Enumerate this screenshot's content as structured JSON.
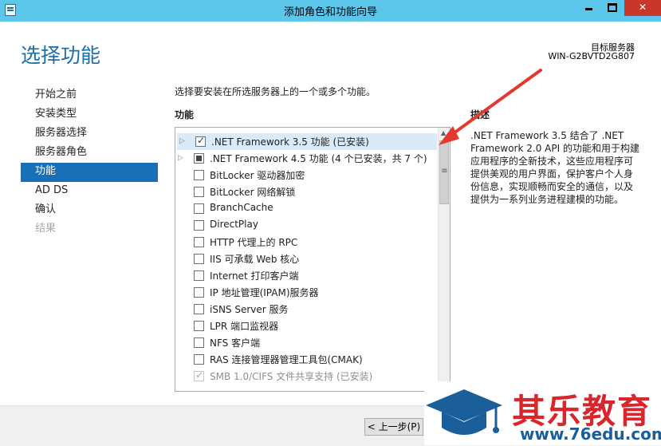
{
  "window": {
    "title": "添加角色和功能向导",
    "close_glyph": "✕"
  },
  "header": {
    "title": "选择功能",
    "target_label": "目标服务器",
    "target_name": "WIN-G2BVTD2G807"
  },
  "nav": {
    "items": [
      {
        "label": "开始之前",
        "state": "normal"
      },
      {
        "label": "安装类型",
        "state": "normal"
      },
      {
        "label": "服务器选择",
        "state": "normal"
      },
      {
        "label": "服务器角色",
        "state": "normal"
      },
      {
        "label": "功能",
        "state": "active"
      },
      {
        "label": "AD DS",
        "state": "normal"
      },
      {
        "label": "确认",
        "state": "normal"
      },
      {
        "label": "结果",
        "state": "disabled"
      }
    ]
  },
  "main": {
    "instruction": "选择要安装在所选服务器上的一个或多个功能。",
    "features_label": "功能",
    "features": [
      {
        "label": ".NET Framework 3.5 功能 (已安装)",
        "check": "checked",
        "expandable": true,
        "selected": true
      },
      {
        "label": ".NET Framework 4.5 功能 (4 个已安装，共 7 个)",
        "check": "partial",
        "expandable": true
      },
      {
        "label": "BitLocker 驱动器加密",
        "check": "none"
      },
      {
        "label": "BitLocker 网络解锁",
        "check": "none"
      },
      {
        "label": "BranchCache",
        "check": "none"
      },
      {
        "label": "DirectPlay",
        "check": "none"
      },
      {
        "label": "HTTP 代理上的 RPC",
        "check": "none"
      },
      {
        "label": "IIS 可承载 Web 核心",
        "check": "none"
      },
      {
        "label": "Internet 打印客户端",
        "check": "none"
      },
      {
        "label": "IP 地址管理(IPAM)服务器",
        "check": "none"
      },
      {
        "label": "iSNS Server 服务",
        "check": "none"
      },
      {
        "label": "LPR 端口监视器",
        "check": "none"
      },
      {
        "label": "NFS 客户端",
        "check": "none"
      },
      {
        "label": "RAS 连接管理器管理工具包(CMAK)",
        "check": "none"
      },
      {
        "label": "SMB 1.0/CIFS 文件共享支持 (已安装)",
        "check": "checked-disabled"
      }
    ]
  },
  "description": {
    "heading": "描述",
    "text": ".NET Framework 3.5 结合了 .NET Framework 2.0 API 的功能和用于构建应用程序的全新技术，这些应用程序可提供美观的用户界面，保护客户个人身份信息，实现顺畅而安全的通信，以及提供为一系列业务进程建模的功能。"
  },
  "footer": {
    "prev_label": "< 上一步(P)"
  },
  "watermark": {
    "brand": "其乐教育",
    "url": "www.76edu.com"
  },
  "colors": {
    "titlebar": "#5cc5ea",
    "accent": "#1a70b6",
    "annotation_arrow": "#e23a2e",
    "brand_red": "#d8272c",
    "brand_blue": "#1a5e9a"
  }
}
